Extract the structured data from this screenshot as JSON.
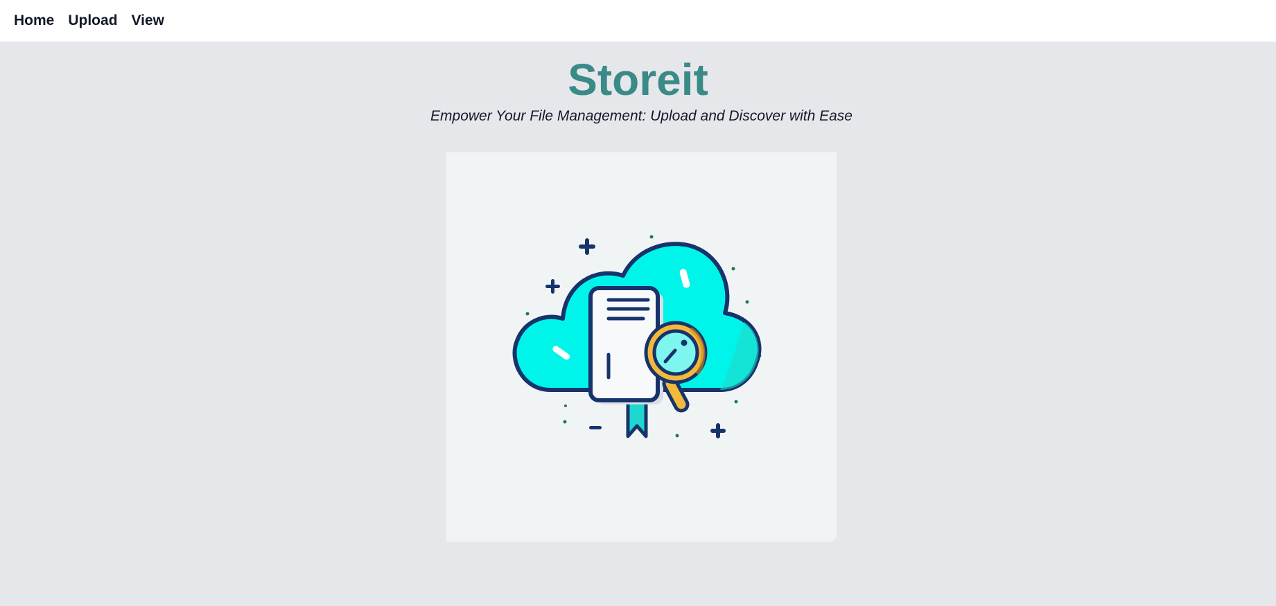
{
  "nav": {
    "links": [
      {
        "label": "Home"
      },
      {
        "label": "Upload"
      },
      {
        "label": "View"
      }
    ]
  },
  "hero": {
    "title": "Storeit",
    "subtitle": "Empower Your File Management: Upload and Discover with Ease"
  },
  "illustration": {
    "icon": "cloud-document-search-icon"
  },
  "colors": {
    "page_background": "#e5e7eb",
    "navbar_background": "#ffffff",
    "title_color": "#3a8a87",
    "cloud_cyan": "#00f5ea",
    "outline_navy": "#16336b",
    "magnifier_gold": "#f2b93b"
  }
}
